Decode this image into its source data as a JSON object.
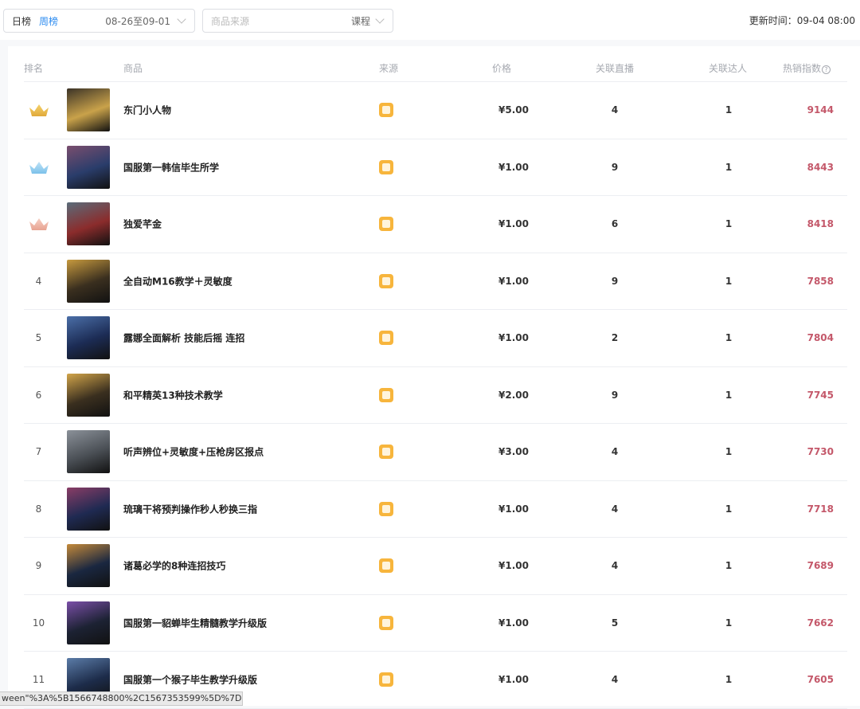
{
  "filters": {
    "tab_day": "日榜",
    "tab_week": "周榜",
    "date_range": "08-26至09-01",
    "source_placeholder": "商品来源",
    "source_value": "课程"
  },
  "updated_label": "更新时间：09-04 08:00",
  "table": {
    "headers": {
      "rank": "排名",
      "product": "商品",
      "source": "来源",
      "price": "价格",
      "live": "关联直播",
      "kol": "关联达人",
      "heat": "热销指数"
    },
    "rows": [
      {
        "rank": "",
        "crown": "gold",
        "name": "东门小人物",
        "price": "¥5.00",
        "live": "4",
        "kol": "1",
        "heat": "9144",
        "thumb": [
          "#c9a24a",
          "#3b3327"
        ]
      },
      {
        "rank": "",
        "crown": "silver",
        "name": "国服第一韩信毕生所学",
        "price": "¥1.00",
        "live": "9",
        "kol": "1",
        "heat": "8443",
        "thumb": [
          "#2a3d6b",
          "#7a4e6e"
        ]
      },
      {
        "rank": "",
        "crown": "bronze",
        "name": "独爱芊金",
        "price": "¥1.00",
        "live": "6",
        "kol": "1",
        "heat": "8418",
        "thumb": [
          "#8b2c2c",
          "#5a6c7a"
        ]
      },
      {
        "rank": "4",
        "name": "全自动M16教学＋灵敏度",
        "price": "¥1.00",
        "live": "9",
        "kol": "1",
        "heat": "7858",
        "thumb": [
          "#3a2f1f",
          "#c79a3e"
        ]
      },
      {
        "rank": "5",
        "name": "露娜全面解析 技能后摇 连招",
        "price": "¥1.00",
        "live": "2",
        "kol": "1",
        "heat": "7804",
        "thumb": [
          "#1c2c55",
          "#4b6fa8"
        ]
      },
      {
        "rank": "6",
        "name": "和平精英13种技术教学",
        "price": "¥2.00",
        "live": "9",
        "kol": "1",
        "heat": "7745",
        "thumb": [
          "#3a2f1f",
          "#d2a54a"
        ]
      },
      {
        "rank": "7",
        "name": "听声辨位+灵敏度+压枪房区报点",
        "price": "¥3.00",
        "live": "4",
        "kol": "1",
        "heat": "7730",
        "thumb": [
          "#4a4f55",
          "#8b9199"
        ]
      },
      {
        "rank": "8",
        "name": "琉璃干将预判操作秒人秒换三指",
        "price": "¥1.00",
        "live": "4",
        "kol": "1",
        "heat": "7718",
        "thumb": [
          "#1f2a52",
          "#8a3d66"
        ]
      },
      {
        "rank": "9",
        "name": "诸葛必学的8种连招技巧",
        "price": "¥1.00",
        "live": "4",
        "kol": "1",
        "heat": "7689",
        "thumb": [
          "#1a2740",
          "#c48a3a"
        ]
      },
      {
        "rank": "10",
        "name": "国服第一貂蝉毕生精髓教学升级版",
        "price": "¥1.00",
        "live": "5",
        "kol": "1",
        "heat": "7662",
        "thumb": [
          "#1c2233",
          "#7b4fa8"
        ]
      },
      {
        "rank": "11",
        "name": "国服第一个猴子毕生教学升级版",
        "price": "¥1.00",
        "live": "4",
        "kol": "1",
        "heat": "7605",
        "thumb": [
          "#1d2c4a",
          "#5b7ca8"
        ]
      }
    ]
  },
  "status_url": "ween\"%3A%5B1566748800%2C1567353599%5D%7D",
  "colors": {
    "accent": "#2d8cf0",
    "heat": "#c4586a",
    "source_icon": "#f7b53c"
  }
}
